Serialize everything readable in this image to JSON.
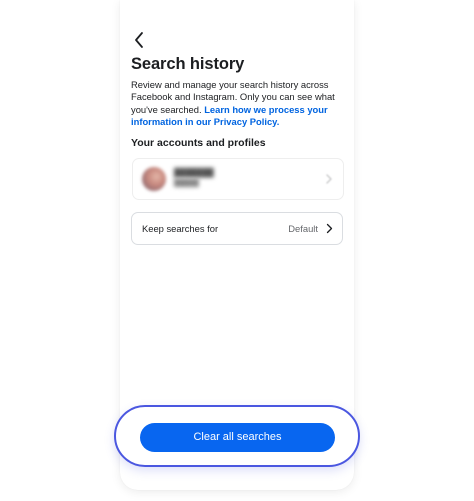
{
  "page": {
    "title": "Search history",
    "description_text": "Review and manage your search history across Facebook and Instagram. Only you can see what you've searched. ",
    "description_link": "Learn how we process your information in our Privacy Policy."
  },
  "accounts": {
    "heading": "Your accounts and profiles"
  },
  "keep_searches": {
    "label": "Keep searches for",
    "value": "Default"
  },
  "actions": {
    "clear_label": "Clear all searches"
  },
  "colors": {
    "accent": "#0866f0",
    "link": "#0064e0",
    "highlight_outline": "#4b57e0"
  }
}
